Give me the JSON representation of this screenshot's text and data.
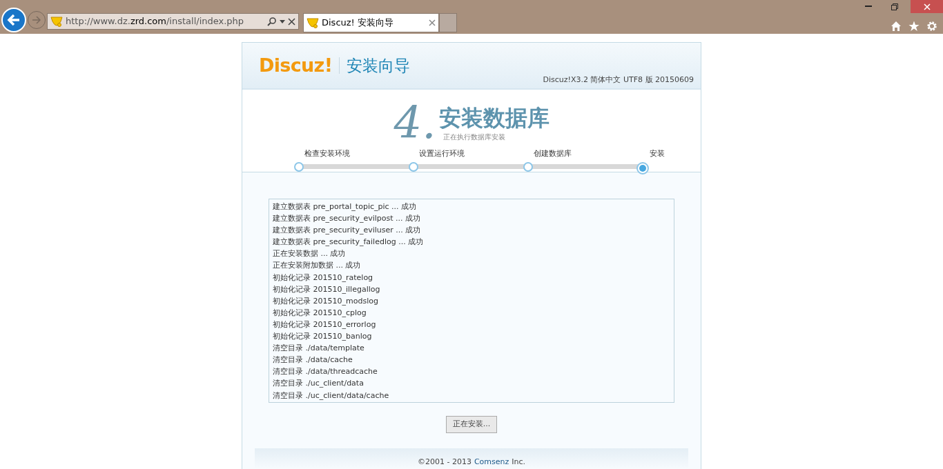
{
  "browser": {
    "address": "http://www.dz.**zrd.com**/install/index.php",
    "tabs": [
      {
        "title": "Discuz! 安装向导",
        "selected": true
      }
    ]
  },
  "header": {
    "logo": "Discuz!",
    "title": "安装向导",
    "version": "Discuz!X3.2 简体中文 UTF8 版 20150609"
  },
  "step": {
    "number": "4.",
    "title": "安装数据库",
    "subtitle": "正在执行数据库安装"
  },
  "steps": [
    {
      "label": "检查安装环境",
      "selected": false
    },
    {
      "label": "设置运行环境",
      "selected": false
    },
    {
      "label": "创建数据库",
      "selected": false
    },
    {
      "label": "安装",
      "selected": true
    }
  ],
  "log": [
    "建立数据表 pre_portal_topic_pic ... 成功",
    "建立数据表 pre_security_evilpost ... 成功",
    "建立数据表 pre_security_eviluser ... 成功",
    "建立数据表 pre_security_failedlog ... 成功",
    "正在安装数据 ... 成功",
    "正在安装附加数据 ... 成功",
    "初始化记录 201510_ratelog",
    "初始化记录 201510_illegallog",
    "初始化记录 201510_modslog",
    "初始化记录 201510_cplog",
    "初始化记录 201510_errorlog",
    "初始化记录 201510_banlog",
    "清空目录 ./data/template",
    "清空目录 ./data/cache",
    "清空目录 ./data/threadcache",
    "清空目录 ./uc_client/data",
    "清空目录 ./uc_client/data/cache"
  ],
  "button": {
    "label": "正在安装...",
    "disabled": true
  },
  "footer": {
    "prefix": "©2001 - 2013",
    "link": "Comsenz",
    "suffix": "Inc."
  }
}
